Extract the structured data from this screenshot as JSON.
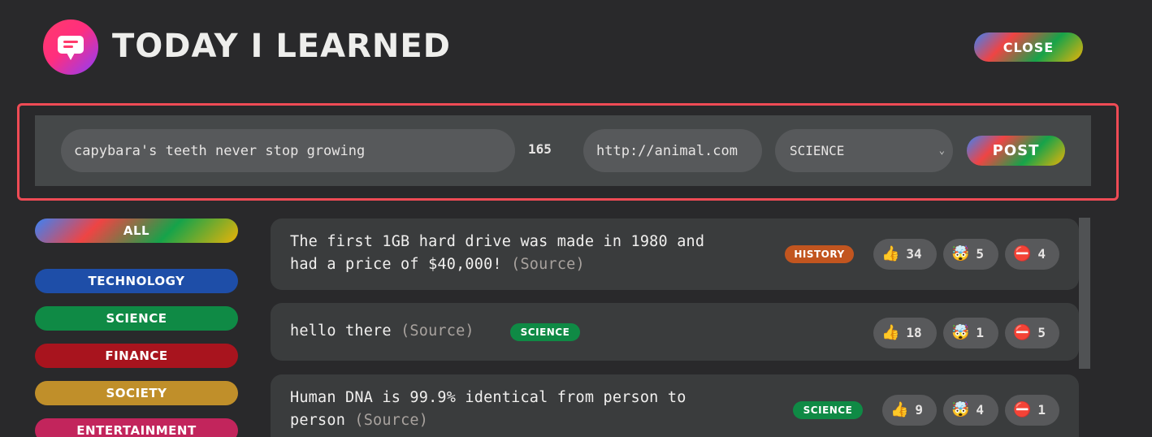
{
  "header": {
    "title": "Today I Learned",
    "close_label": "Close"
  },
  "form": {
    "fact_value": "capybara's teeth never stop growing",
    "char_count": "165",
    "source_value": "http://animal.com",
    "category_selected": "SCIENCE",
    "post_label": "Post"
  },
  "categories": [
    {
      "label": "All",
      "color": "rainbow"
    },
    {
      "label": "Technology",
      "color": "#1e4ea8"
    },
    {
      "label": "Science",
      "color": "#0f8a45"
    },
    {
      "label": "Finance",
      "color": "#a8141e"
    },
    {
      "label": "Society",
      "color": "#c08f2a"
    },
    {
      "label": "Entertainment",
      "color": "#c2255c"
    }
  ],
  "facts": [
    {
      "line1": "The first 1GB hard drive was made in 1980 and",
      "line2": "had a price of $40,000!",
      "source": "(Source)",
      "tag": "History",
      "tag_color": "#c2551f",
      "likes": "34",
      "mindblown": "5",
      "false": "4"
    },
    {
      "line1": "hello there",
      "source": "(Source)",
      "tag": "Science",
      "tag_color": "#0f8a45",
      "likes": "18",
      "mindblown": "1",
      "false": "5"
    },
    {
      "line1": "Human DNA is 99.9% identical from person to",
      "line2": "person",
      "source": "(Source)",
      "tag": "Science",
      "tag_color": "#0f8a45",
      "likes": "9",
      "mindblown": "4",
      "false": "1"
    }
  ],
  "icons": {
    "like": "thumbs-up-icon",
    "mindblown": "mind-blown-icon",
    "false": "no-entry-icon"
  }
}
